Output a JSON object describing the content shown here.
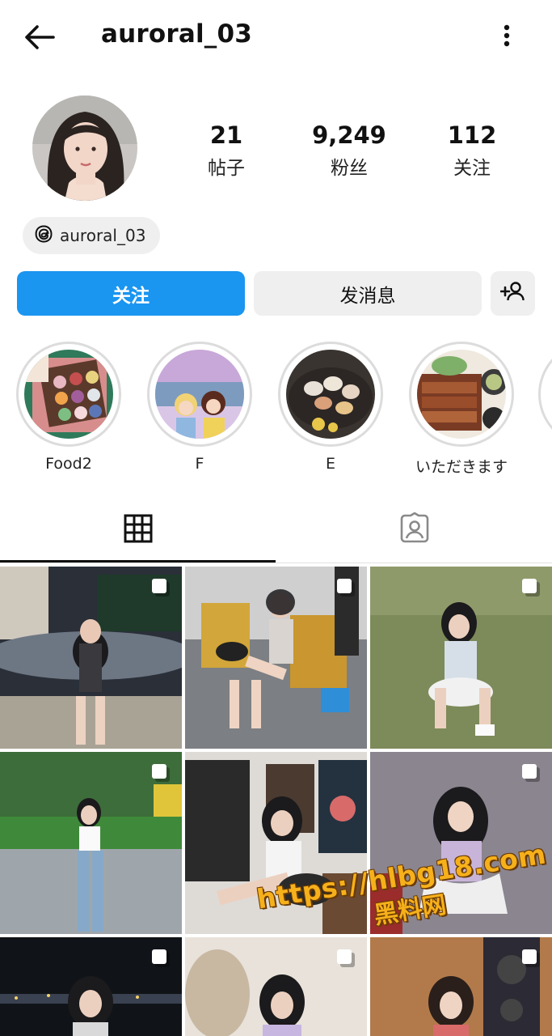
{
  "header": {
    "username": "auroral_03"
  },
  "profile": {
    "stats": [
      {
        "value": "21",
        "label": "帖子"
      },
      {
        "value": "9,249",
        "label": "粉丝"
      },
      {
        "value": "112",
        "label": "关注"
      }
    ],
    "threads_handle": "auroral_03"
  },
  "actions": {
    "follow_label": "关注",
    "message_label": "发消息"
  },
  "highlights": [
    {
      "caption": "Food2"
    },
    {
      "caption": "F"
    },
    {
      "caption": "E"
    },
    {
      "caption": "いただきます"
    }
  ],
  "watermark": {
    "url": "https://hlbg18.com",
    "text": "黑料网"
  },
  "colors": {
    "accent": "#1a95f0",
    "button_gray": "#efefef",
    "watermark": "#f6b01b"
  }
}
